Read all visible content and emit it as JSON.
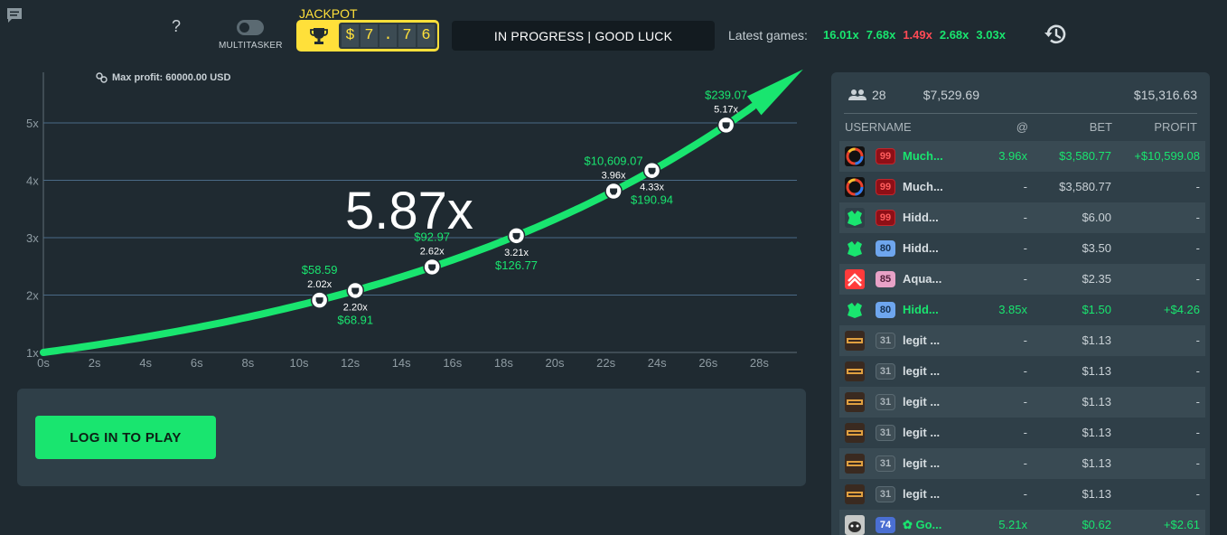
{
  "header": {
    "help_label": "?",
    "multitasker_label": "MULTITASKER",
    "jackpot_label": "JACKPOT",
    "jackpot_digits": [
      "$",
      "7",
      ".",
      "7",
      "6"
    ],
    "status": "IN PROGRESS | GOOD LUCK",
    "latest_label": "Latest games:",
    "latest_games": [
      {
        "value": "16.01x",
        "color": "#19e56f"
      },
      {
        "value": "7.68x",
        "color": "#19e56f"
      },
      {
        "value": "1.49x",
        "color": "#ff4a55"
      },
      {
        "value": "2.68x",
        "color": "#19e56f"
      },
      {
        "value": "3.03x",
        "color": "#19e56f"
      }
    ],
    "icons": [
      "chat-icon",
      "toggle-switch",
      "trophy-icon",
      "history-icon"
    ]
  },
  "game": {
    "max_profit": "Max profit: 60000.00 USD",
    "current_multiplier": "5.87x",
    "accent_color": "#19e56f",
    "y_ticks": [
      "1x",
      "2x",
      "3x",
      "4x",
      "5x"
    ],
    "x_ticks": [
      "0s",
      "2s",
      "4s",
      "6s",
      "8s",
      "10s",
      "12s",
      "14s",
      "16s",
      "18s",
      "20s",
      "22s",
      "24s",
      "26s",
      "28s"
    ],
    "cashouts": [
      {
        "t": 10.8,
        "mult": 2.02,
        "mult_label": "2.02x",
        "amount": "$58.59",
        "label_pos": "above"
      },
      {
        "t": 12.2,
        "mult": 2.2,
        "mult_label": "2.20x",
        "amount": "$68.91",
        "label_pos": "below"
      },
      {
        "t": 15.2,
        "mult": 2.62,
        "mult_label": "2.62x",
        "amount": "$92.97",
        "label_pos": "above"
      },
      {
        "t": 18.5,
        "mult": 3.21,
        "mult_label": "3.21x",
        "amount": "$126.77",
        "label_pos": "below"
      },
      {
        "t": 22.3,
        "mult": 3.96,
        "mult_label": "3.96x",
        "amount": "$10,609.07",
        "label_pos": "above"
      },
      {
        "t": 23.8,
        "mult": 4.33,
        "mult_label": "4.33x",
        "amount": "$190.94",
        "label_pos": "below"
      },
      {
        "t": 26.7,
        "mult": 5.17,
        "mult_label": "5.17x",
        "amount": "$239.07",
        "label_pos": "above"
      }
    ],
    "curve_end": {
      "t": 29.5,
      "mult": 5.87
    }
  },
  "login": {
    "button_label": "LOG IN TO PLAY"
  },
  "players": {
    "count": "28",
    "total_bet": "$7,529.69",
    "total_profit": "$15,316.63",
    "columns": {
      "username": "USERNAME",
      "at": "@",
      "bet": "BET",
      "profit": "PROFIT"
    },
    "rows": [
      {
        "avatar": "ring",
        "level": "99",
        "level_style": "red",
        "name": "Much...",
        "at": "3.96x",
        "bet": "$3,580.77",
        "profit": "+$10,599.08",
        "won": true
      },
      {
        "avatar": "ring",
        "level": "99",
        "level_style": "red",
        "name": "Much...",
        "at": "-",
        "bet": "$3,580.77",
        "profit": "-",
        "won": false
      },
      {
        "avatar": "green",
        "level": "99",
        "level_style": "red",
        "name": "Hidd...",
        "at": "-",
        "bet": "$6.00",
        "profit": "-",
        "won": false
      },
      {
        "avatar": "green",
        "level": "80",
        "level_style": "blue",
        "name": "Hidd...",
        "at": "-",
        "bet": "$3.50",
        "profit": "-",
        "won": false
      },
      {
        "avatar": "red",
        "level": "85",
        "level_style": "pink",
        "name": "Aqua...",
        "at": "-",
        "bet": "$2.35",
        "profit": "-",
        "won": false
      },
      {
        "avatar": "green",
        "level": "80",
        "level_style": "blue",
        "name": "Hidd...",
        "at": "3.85x",
        "bet": "$1.50",
        "profit": "+$4.26",
        "won": true
      },
      {
        "avatar": "juicy",
        "level": "31",
        "level_style": "gray",
        "name": "legit ...",
        "at": "-",
        "bet": "$1.13",
        "profit": "-",
        "won": false
      },
      {
        "avatar": "juicy",
        "level": "31",
        "level_style": "gray",
        "name": "legit ...",
        "at": "-",
        "bet": "$1.13",
        "profit": "-",
        "won": false
      },
      {
        "avatar": "juicy",
        "level": "31",
        "level_style": "gray",
        "name": "legit ...",
        "at": "-",
        "bet": "$1.13",
        "profit": "-",
        "won": false
      },
      {
        "avatar": "juicy",
        "level": "31",
        "level_style": "gray",
        "name": "legit ...",
        "at": "-",
        "bet": "$1.13",
        "profit": "-",
        "won": false
      },
      {
        "avatar": "juicy",
        "level": "31",
        "level_style": "gray",
        "name": "legit ...",
        "at": "-",
        "bet": "$1.13",
        "profit": "-",
        "won": false
      },
      {
        "avatar": "juicy",
        "level": "31",
        "level_style": "gray",
        "name": "legit ...",
        "at": "-",
        "bet": "$1.13",
        "profit": "-",
        "won": false
      },
      {
        "avatar": "cat",
        "level": "74",
        "level_style": "navy",
        "name": "✿ Go...",
        "at": "5.21x",
        "bet": "$0.62",
        "profit": "+$2.61",
        "won": true
      }
    ]
  }
}
